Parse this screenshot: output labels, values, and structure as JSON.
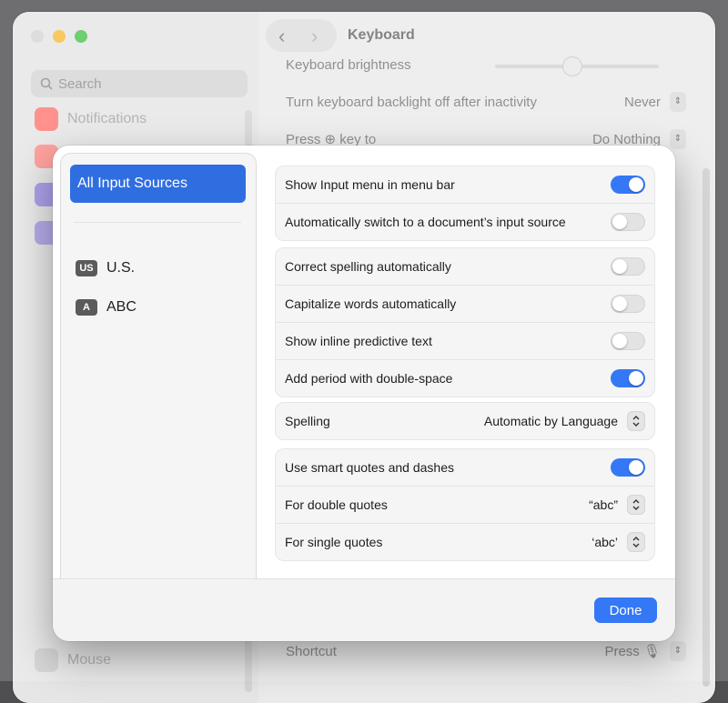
{
  "background": {
    "window_title": "Keyboard",
    "search_placeholder": "Search",
    "sidebar": [
      {
        "label": "Notifications",
        "color": "#ff5f57"
      },
      {
        "label": "Mouse",
        "color": "#bdbdbd"
      }
    ],
    "rows": [
      {
        "label": "Keyboard brightness"
      },
      {
        "label": "Turn keyboard backlight off after inactivity",
        "value": "Never"
      },
      {
        "label": "Press ⊕ key to",
        "value": "Do Nothing"
      },
      {
        "label": "Shortcut",
        "value": "Press 🎙"
      }
    ]
  },
  "sheet": {
    "sources": {
      "selected": "All Input Sources",
      "items": [
        {
          "badge": "US",
          "label": "U.S."
        },
        {
          "badge": "A",
          "label": "ABC"
        }
      ],
      "add_label": "+",
      "remove_label": "−"
    },
    "group1": [
      {
        "label": "Show Input menu in menu bar",
        "on": true
      },
      {
        "label": "Automatically switch to a document’s input source",
        "on": false
      }
    ],
    "group2": [
      {
        "label": "Correct spelling automatically",
        "on": false
      },
      {
        "label": "Capitalize words automatically",
        "on": false
      },
      {
        "label": "Show inline predictive text",
        "on": false
      },
      {
        "label": "Add period with double-space",
        "on": true
      }
    ],
    "spelling": {
      "label": "Spelling",
      "value": "Automatic by Language"
    },
    "quotes": {
      "smart": {
        "label": "Use smart quotes and dashes",
        "on": true
      },
      "double": {
        "label": "For double quotes",
        "value": "“abc”"
      },
      "single": {
        "label": "For single quotes",
        "value": "‘abc’"
      }
    },
    "done_label": "Done"
  },
  "colors": {
    "accent": "#3478f6",
    "selection": "#2f6ee0"
  }
}
